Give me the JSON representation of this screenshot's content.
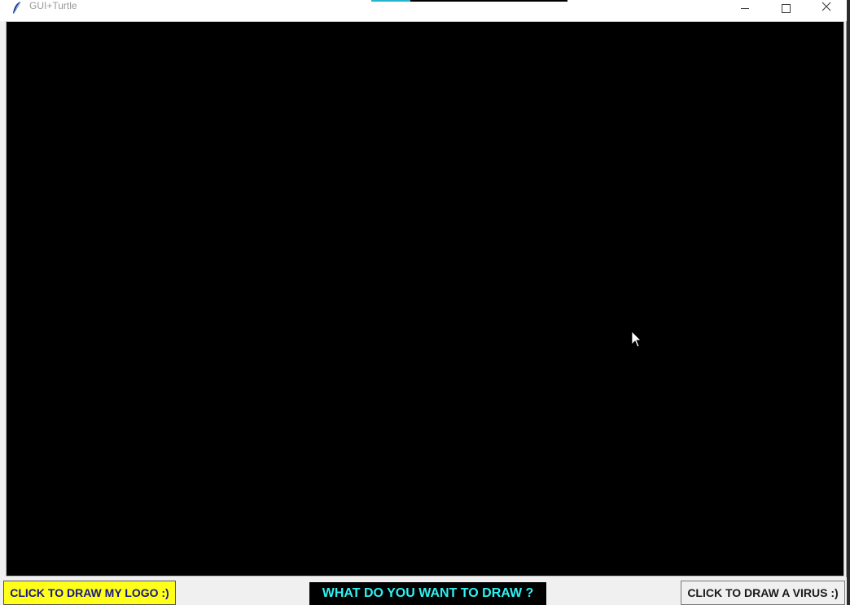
{
  "window": {
    "title": "GUI+Turtle",
    "controls": [
      "minimize",
      "maximize",
      "close"
    ]
  },
  "canvas": {
    "background": "#000000"
  },
  "bottom_bar": {
    "logo_button_label": "CLICK TO DRAW MY LOGO :)",
    "prompt_label": "WHAT DO YOU WANT TO DRAW ?",
    "virus_button_label": "CLICK TO DRAW A VIRUS :)"
  },
  "colors": {
    "logo_button_bg": "#ffff1a",
    "logo_button_text": "#16168a",
    "prompt_bg": "#000000",
    "prompt_text": "#2ff3f3",
    "virus_button_bg": "#f0f0f0"
  },
  "icons": {
    "app": "feather-icon",
    "minimize": "minimize-icon",
    "maximize": "maximize-icon",
    "close": "close-icon",
    "cursor": "mouse-cursor-icon"
  }
}
